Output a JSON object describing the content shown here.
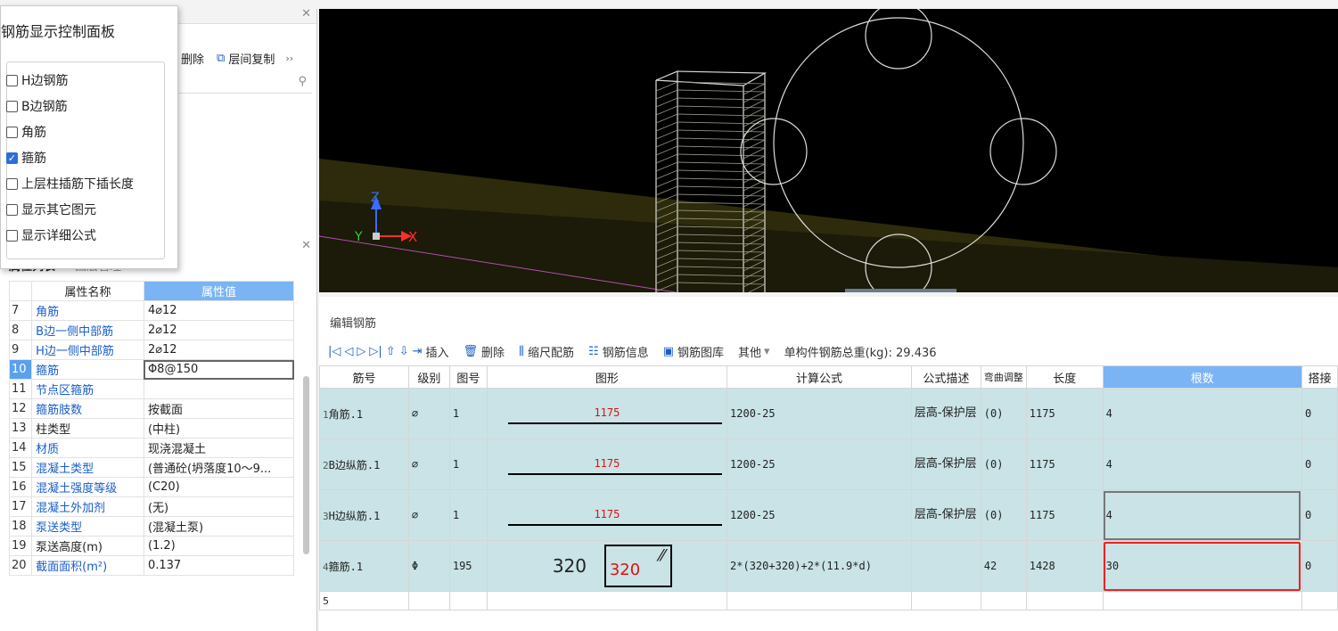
{
  "popup": {
    "title": "钢筋显示控制面板",
    "options": [
      {
        "label": "H边钢筋",
        "checked": false
      },
      {
        "label": "B边钢筋",
        "checked": false
      },
      {
        "label": "角筋",
        "checked": false
      },
      {
        "label": "箍筋",
        "checked": true
      },
      {
        "label": "上层柱插筋下插长度",
        "checked": false
      },
      {
        "label": "显示其它图元",
        "checked": false
      },
      {
        "label": "显示详细公式",
        "checked": false
      }
    ]
  },
  "left_toolbar": {
    "delete_label": "删除",
    "floor_copy_label": "层间复制",
    "more": "››"
  },
  "prop_tabs": {
    "attr_list": "属性列表",
    "layer_mgr": "图层管理"
  },
  "prop_table": {
    "col_name": "属性名称",
    "col_value": "属性值",
    "rows": [
      {
        "n": "7",
        "name": "角筋",
        "value": "4⌀12",
        "blue": true
      },
      {
        "n": "8",
        "name": "B边一侧中部筋",
        "value": "2⌀12",
        "blue": true
      },
      {
        "n": "9",
        "name": "H边一侧中部筋",
        "value": "2⌀12",
        "blue": true
      },
      {
        "n": "10",
        "name": "箍筋",
        "value": "Φ8@150",
        "blue": true,
        "selected": true
      },
      {
        "n": "11",
        "name": "节点区箍筋",
        "value": "",
        "blue": true
      },
      {
        "n": "12",
        "name": "箍筋肢数",
        "value": "按截面",
        "blue": true
      },
      {
        "n": "13",
        "name": "柱类型",
        "value": "(中柱)",
        "blue": false
      },
      {
        "n": "14",
        "name": "材质",
        "value": "现浇混凝土",
        "blue": true
      },
      {
        "n": "15",
        "name": "混凝土类型",
        "value": "(普通砼(坍落度10～9...",
        "blue": true
      },
      {
        "n": "16",
        "name": "混凝土强度等级",
        "value": "(C20)",
        "blue": true
      },
      {
        "n": "17",
        "name": "混凝土外加剂",
        "value": "(无)",
        "blue": true
      },
      {
        "n": "18",
        "name": "泵送类型",
        "value": "(混凝土泵)",
        "blue": true
      },
      {
        "n": "19",
        "name": "泵送高度(m)",
        "value": "(1.2)",
        "blue": false
      },
      {
        "n": "20",
        "name": "截面面积(m²)",
        "value": "0.137",
        "blue": true
      }
    ]
  },
  "viewport": {
    "axis_z": "Z",
    "axis_y": "Y",
    "axis_x": "X"
  },
  "editor": {
    "title": "编辑钢筋",
    "toolbar": {
      "insert": "插入",
      "delete": "删除",
      "scale_rebar": "缩尺配筋",
      "rebar_info": "钢筋信息",
      "rebar_lib": "钢筋图库",
      "other": "其他",
      "total_weight": "单构件钢筋总重(kg): 29.436"
    },
    "headers": [
      "筋号",
      "级别",
      "图号",
      "图形",
      "计算公式",
      "公式描述",
      "弯曲调整",
      "长度",
      "根数",
      "搭接"
    ],
    "rows": [
      {
        "n": "1",
        "bar": "角筋.1",
        "grade": "⌀",
        "fig": "1",
        "shape": "1175",
        "formula": "1200-25",
        "desc": "层高-保护层",
        "bend": "(0)",
        "length": "1175",
        "count": "4",
        "lap": "0"
      },
      {
        "n": "2",
        "bar": "B边纵筋.1",
        "grade": "⌀",
        "fig": "1",
        "shape": "1175",
        "formula": "1200-25",
        "desc": "层高-保护层",
        "bend": "(0)",
        "length": "1175",
        "count": "4",
        "lap": "0"
      },
      {
        "n": "3",
        "bar": "H边纵筋.1",
        "grade": "⌀",
        "fig": "1",
        "shape": "1175",
        "formula": "1200-25",
        "desc": "层高-保护层",
        "bend": "(0)",
        "length": "1175",
        "count": "4",
        "lap": "0"
      },
      {
        "n": "4",
        "bar": "箍筋.1",
        "grade": "Φ",
        "fig": "195",
        "shape_w": "320",
        "shape_h": "320",
        "formula": "2*(320+320)+2*(11.9*d)",
        "desc": "",
        "bend": "42",
        "length": "1428",
        "count": "30",
        "lap": "0"
      },
      {
        "n": "5"
      }
    ]
  }
}
